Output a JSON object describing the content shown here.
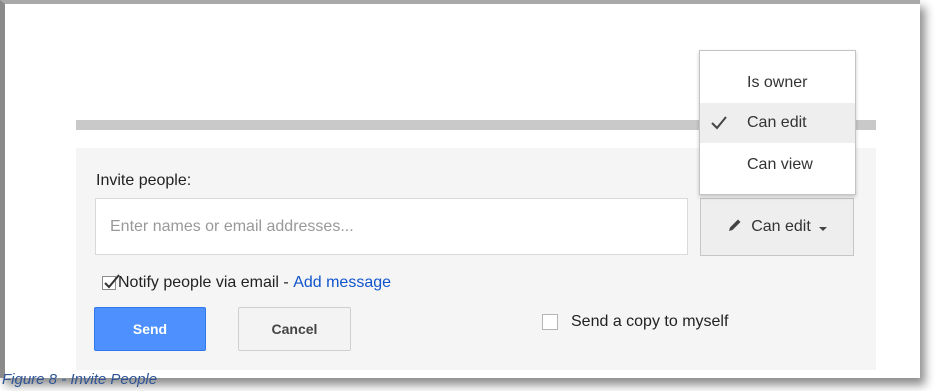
{
  "invite": {
    "label": "Invite people:",
    "placeholder": "Enter names or email addresses...",
    "value": ""
  },
  "permission_button": {
    "label": "Can edit",
    "icon": "pencil-icon"
  },
  "dropdown": {
    "items": [
      {
        "label": "Is owner",
        "selected": false
      },
      {
        "label": "Can edit",
        "selected": true
      },
      {
        "label": "Can view",
        "selected": false
      }
    ]
  },
  "notify": {
    "label": "Notify people via email - ",
    "link": "Add message",
    "checked": true
  },
  "buttons": {
    "send": "Send",
    "cancel": "Cancel"
  },
  "copy": {
    "label": "Send a copy to myself",
    "checked": false
  },
  "caption": "Figure 8 - Invite People",
  "colors": {
    "send_button": "#4d90fe",
    "link": "#1155cc",
    "panel_bg": "#f5f5f5"
  }
}
